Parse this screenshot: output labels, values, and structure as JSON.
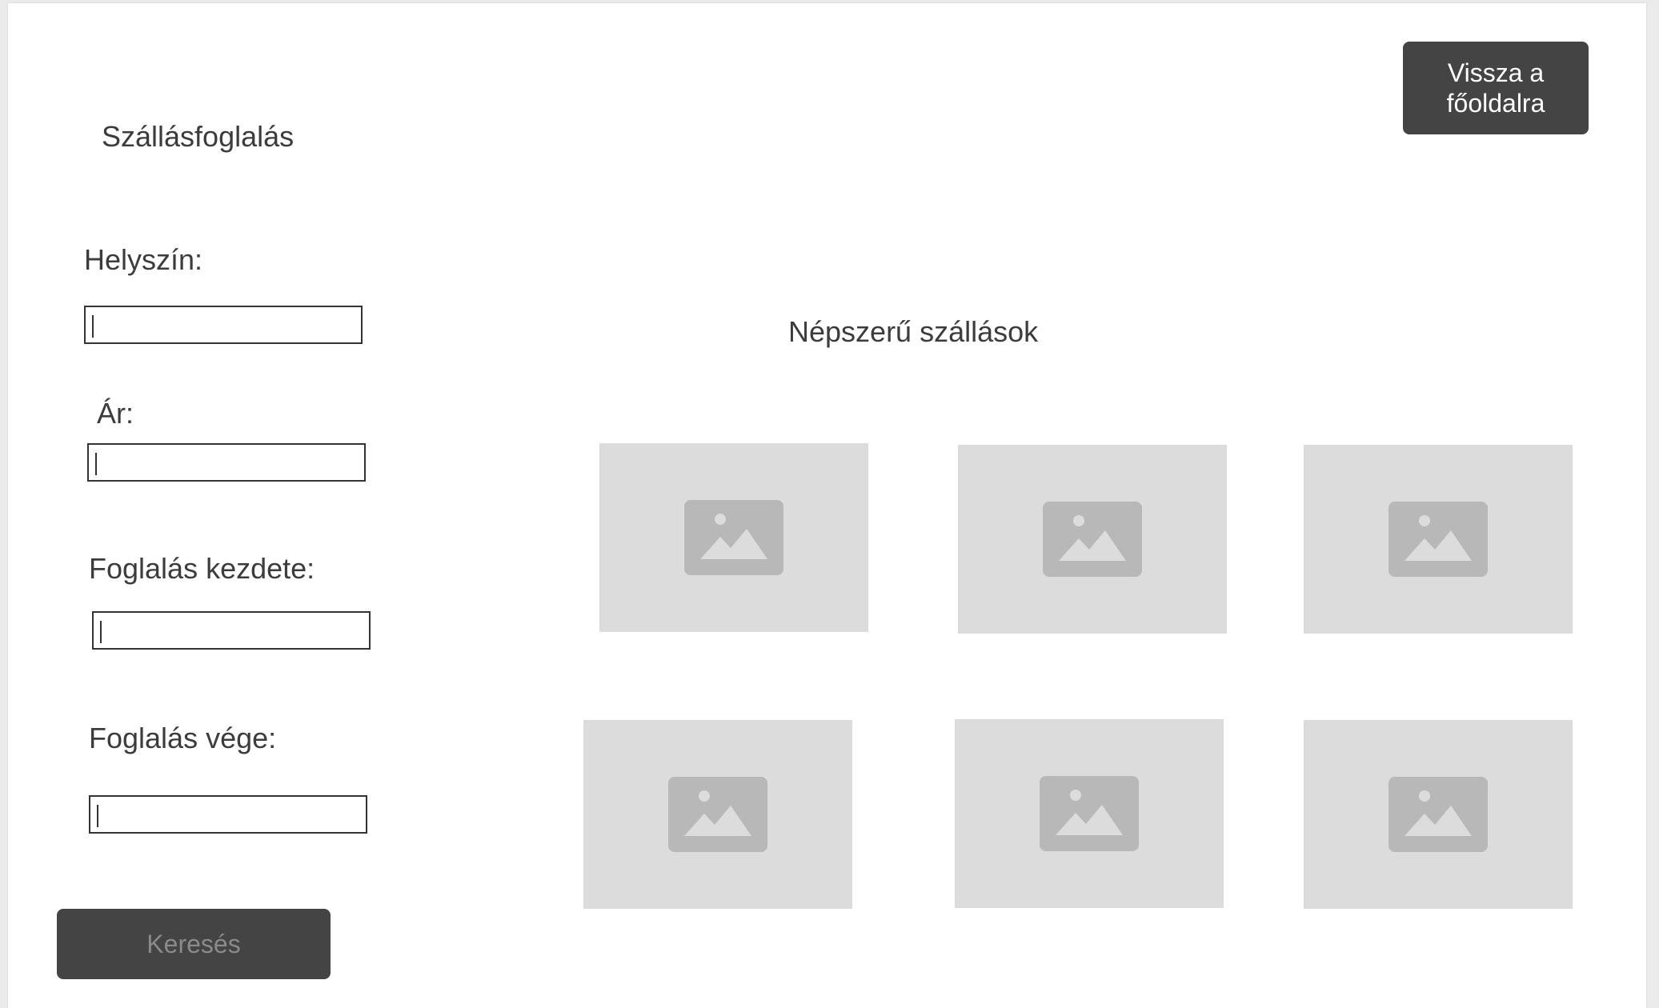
{
  "page": {
    "title": "Szállásfoglalás",
    "back_button": "Vissza a főoldalra",
    "search_button": "Keresés"
  },
  "form": {
    "fields": [
      {
        "label": "Helyszín:",
        "value": ""
      },
      {
        "label": "Ár:",
        "value": ""
      },
      {
        "label": "Foglalás kezdete:",
        "value": ""
      },
      {
        "label": "Foglalás vége:",
        "value": ""
      }
    ]
  },
  "popular": {
    "title": "Népszerű szállások",
    "items": [
      {
        "icon": "image-placeholder-icon"
      },
      {
        "icon": "image-placeholder-icon"
      },
      {
        "icon": "image-placeholder-icon"
      },
      {
        "icon": "image-placeholder-icon"
      },
      {
        "icon": "image-placeholder-icon"
      },
      {
        "icon": "image-placeholder-icon"
      }
    ]
  },
  "colors": {
    "button_bg": "#444444",
    "placeholder_bg": "#dcdcdc",
    "placeholder_icon": "#b8b8b8"
  }
}
